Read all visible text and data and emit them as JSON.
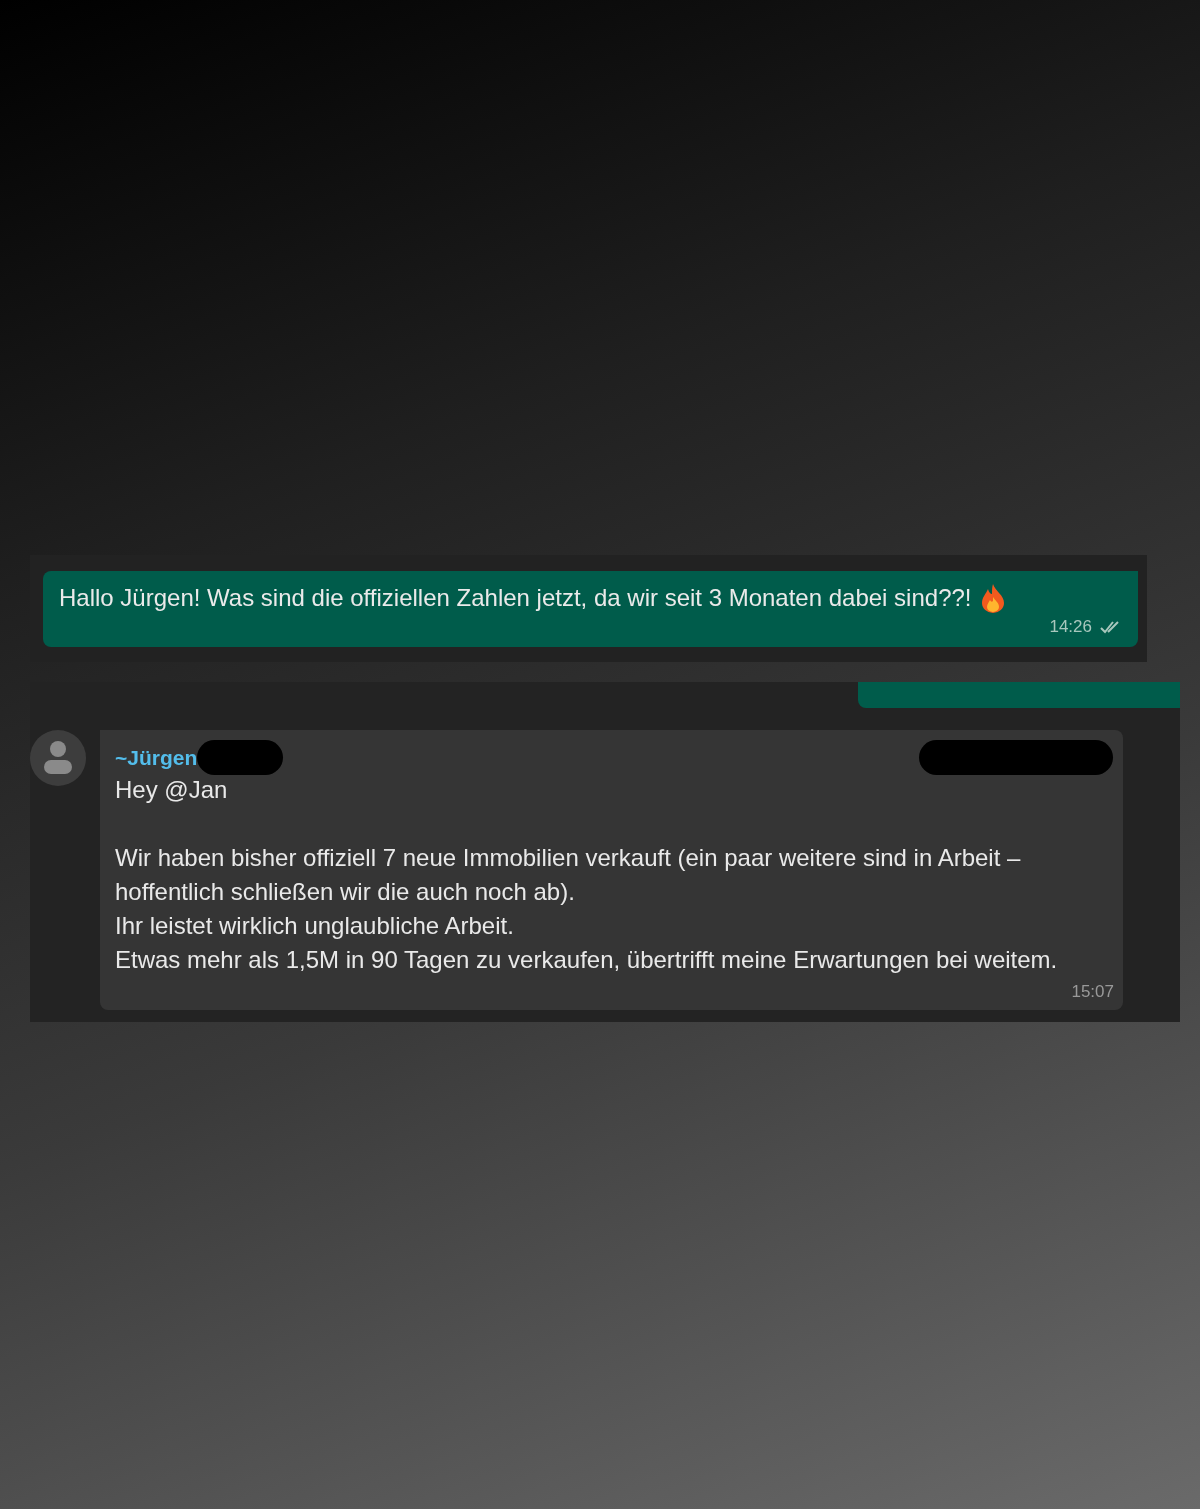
{
  "messages": [
    {
      "kind": "outgoing",
      "text": "Hallo Jürgen! Was sind die offiziellen Zahlen jetzt, da wir seit 3 Monaten dabei sind??!",
      "emoji": true,
      "time": "14:26",
      "read": false
    },
    {
      "kind": "incoming",
      "sender": "~Jürgen",
      "text": "Hey @Jan\n\nWir haben bisher offiziell 7 neue Immobilien verkauft (ein paar weitere sind in Arbeit – hoffentlich schließen wir die auch noch ab).\nIhr leistet wirklich unglaubliche Arbeit.\nEtwas mehr als 1,5M in 90 Tagen zu verkaufen, übertrifft meine Erwartungen bei weitem.",
      "time": "15:07",
      "redacted": true
    }
  ]
}
